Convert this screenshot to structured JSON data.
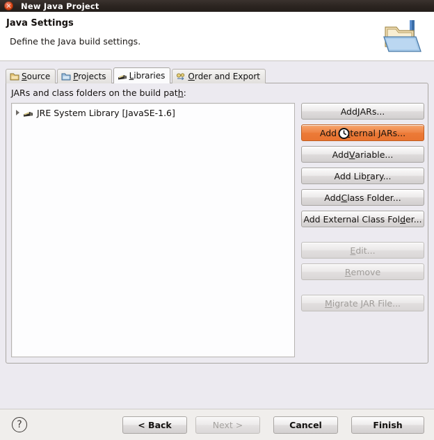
{
  "window": {
    "title": "New Java Project",
    "close_icon": "close-icon"
  },
  "header": {
    "title": "Java Settings",
    "subtitle": "Define the Java build settings.",
    "icon": "java-project-folder-icon"
  },
  "tabs": [
    {
      "label": "Source",
      "mnemonic": "S",
      "icon": "source-folder-icon",
      "active": false
    },
    {
      "label": "Projects",
      "mnemonic": "P",
      "icon": "projects-folder-icon",
      "active": false
    },
    {
      "label": "Libraries",
      "mnemonic": "L",
      "icon": "libraries-icon",
      "active": true
    },
    {
      "label": "Order and Export",
      "mnemonic": "O",
      "icon": "order-export-icon",
      "active": false
    }
  ],
  "libraries_tab": {
    "list_label_pre": "JARs and class folders on the build pat",
    "list_label_mnemonic": "h",
    "list_label_post": ":",
    "tree_items": [
      {
        "label": "JRE System Library [JavaSE-1.6]",
        "icon": "library-icon",
        "expanded": false
      }
    ],
    "buttons": [
      {
        "pre": "Add ",
        "mnemonic": "J",
        "post": "ARs...",
        "state": "highlighted-not"
      },
      {
        "pre": "Add E",
        "mnemonic": "x",
        "post": "ternal JARs...",
        "state": "hovered"
      },
      {
        "pre": "Add ",
        "mnemonic": "V",
        "post": "ariable...",
        "state": "normal"
      },
      {
        "pre": "Add Lib",
        "mnemonic": "r",
        "post": "ary...",
        "state": "normal"
      },
      {
        "pre": "Add ",
        "mnemonic": "C",
        "post": "lass Folder...",
        "state": "normal"
      },
      {
        "pre": "Add External Class Fol",
        "mnemonic": "d",
        "post": "er...",
        "state": "normal"
      },
      {
        "pre": "",
        "mnemonic": "E",
        "post": "dit...",
        "state": "disabled"
      },
      {
        "pre": "",
        "mnemonic": "R",
        "post": "emove",
        "state": "disabled"
      },
      {
        "pre": "",
        "mnemonic": "M",
        "post": "igrate JAR File...",
        "state": "disabled"
      }
    ],
    "cursor": "busy-wait-cursor"
  },
  "footer": {
    "help_label": "?",
    "help_icon": "help-icon",
    "back_label": "< Back",
    "next_label": "Next >",
    "cancel_label": "Cancel",
    "finish_label": "Finish"
  },
  "colors": {
    "titlebar": "#2b2420",
    "close_button": "#da4716",
    "hover_button": "#ec7a37",
    "panel_background": "#eceaf0",
    "list_background": "#fdfdfe"
  }
}
